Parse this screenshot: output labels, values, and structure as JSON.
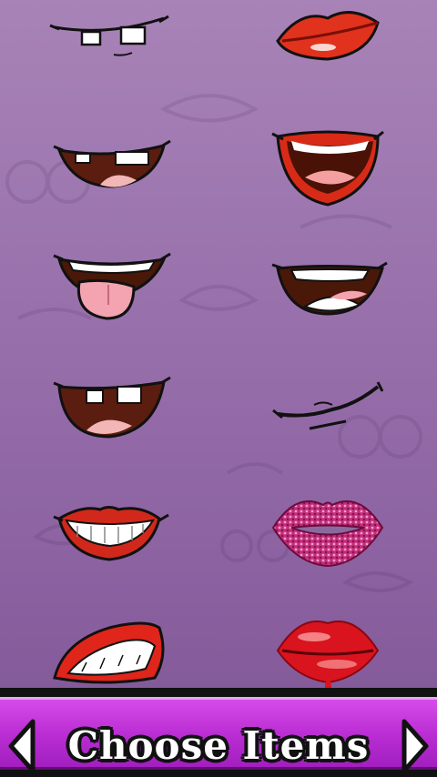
{
  "bottom_bar": {
    "title": "Choose Items",
    "prev_icon": "arrow-left-icon",
    "next_icon": "arrow-right-icon"
  },
  "items": [
    {
      "id": "cartoon-gap-teeth-smile",
      "icon": "mouth-icon"
    },
    {
      "id": "red-pouty-lips",
      "icon": "mouth-icon"
    },
    {
      "id": "cartoon-open-smile-tooth",
      "icon": "mouth-icon"
    },
    {
      "id": "red-laughing-mouth",
      "icon": "mouth-icon"
    },
    {
      "id": "cartoon-tongue-out",
      "icon": "mouth-icon"
    },
    {
      "id": "cartoon-wide-grin",
      "icon": "mouth-icon"
    },
    {
      "id": "cartoon-open-mouth-two-teeth",
      "icon": "mouth-icon"
    },
    {
      "id": "line-smirk",
      "icon": "mouth-icon"
    },
    {
      "id": "red-lips-smile",
      "icon": "mouth-icon"
    },
    {
      "id": "pink-glitter-lips",
      "icon": "mouth-icon"
    },
    {
      "id": "red-lips-teeth-bite",
      "icon": "mouth-icon"
    },
    {
      "id": "glossy-dripping-lips",
      "icon": "mouth-icon"
    }
  ]
}
